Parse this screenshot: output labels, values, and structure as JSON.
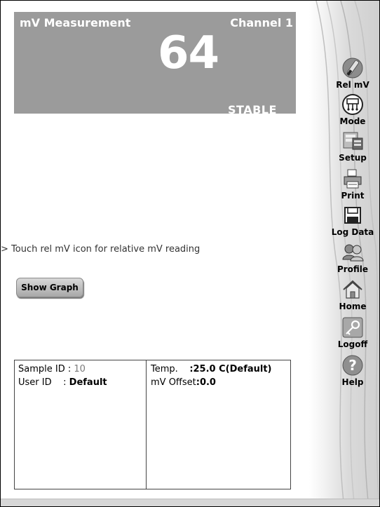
{
  "readout": {
    "mode_title": "mV Measurement",
    "channel": "Channel 1",
    "value": "64",
    "stability": "STABLE"
  },
  "menu": [
    {
      "id": "rel-mv",
      "label": "Rel mV",
      "icon": "rel-mv-icon"
    },
    {
      "id": "mode",
      "label": "Mode",
      "icon": "mode-icon"
    },
    {
      "id": "setup",
      "label": "Setup",
      "icon": "setup-icon"
    },
    {
      "id": "print",
      "label": "Print",
      "icon": "printer-icon"
    },
    {
      "id": "log-data",
      "label": "Log Data",
      "icon": "floppy-disk-icon"
    },
    {
      "id": "profile",
      "label": "Profile",
      "icon": "users-icon"
    },
    {
      "id": "home",
      "label": "Home",
      "icon": "home-icon"
    },
    {
      "id": "logoff",
      "label": "Logoff",
      "icon": "key-icon"
    },
    {
      "id": "help",
      "label": "Help",
      "icon": "help-icon"
    }
  ],
  "hint": "> Touch rel mV icon for relative mV reading",
  "show_graph_label": "Show Graph",
  "info": {
    "sample_id_label": "Sample ID",
    "sample_id_value": "10",
    "user_id_label": "User ID",
    "user_id_value": "Default",
    "temp_label": "Temp.",
    "temp_value": ":25.0 C(Default)",
    "mv_offset_label": "mV Offset",
    "mv_offset_value": ":0.0"
  },
  "colors": {
    "readout_bg": "#9b9b9b",
    "readout_text": "#ffffff",
    "muted": "#7a7a7a"
  }
}
